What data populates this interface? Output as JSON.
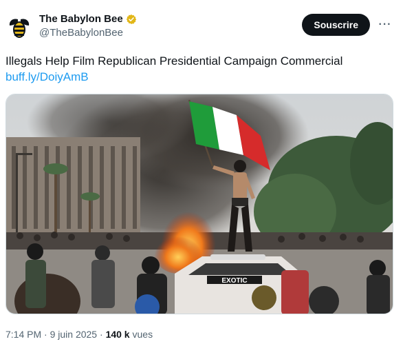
{
  "account": {
    "display_name": "The Babylon Bee",
    "handle": "@TheBabylonBee",
    "verified": true,
    "avatar_icon": "bee-logo-icon",
    "verified_icon": "verified-badge-icon",
    "badge_color": "#e2b719"
  },
  "actions": {
    "subscribe_label": "Souscrire",
    "more_label": "···"
  },
  "tweet": {
    "text": "Illegals Help Film Republican Presidential Campaign Commercial",
    "link": "buff.ly/DoiyAmB"
  },
  "meta": {
    "time": "7:14 PM",
    "separator1": " · ",
    "date": "9 juin 2025",
    "separator2": " · ",
    "views_count": "140 k",
    "views_label": " vues"
  },
  "media": {
    "car_text": "EXOTIC",
    "flag_colors": [
      "#1f9c3a",
      "#ffffff",
      "#d62b2b"
    ]
  }
}
